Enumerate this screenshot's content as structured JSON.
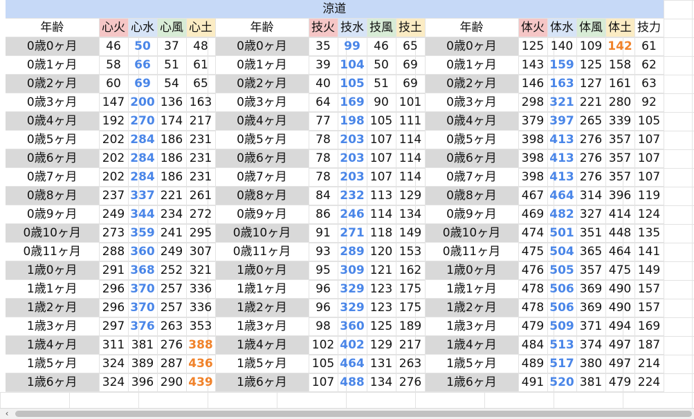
{
  "title": "涼道",
  "columns": [
    "年齢",
    "心火",
    "心水",
    "心風",
    "心土",
    "年齢",
    "技火",
    "技水",
    "技風",
    "技土",
    "年齢",
    "体火",
    "体水",
    "体風",
    "体土",
    "技力"
  ],
  "rows": [
    [
      "0歳0ヶ月",
      "46",
      "50",
      "37",
      "48",
      "0歳0ヶ月",
      "35",
      "99",
      "46",
      "65",
      "0歳0ヶ月",
      "125",
      "140",
      "109",
      "142",
      "61"
    ],
    [
      "0歳1ヶ月",
      "58",
      "66",
      "51",
      "61",
      "0歳1ヶ月",
      "39",
      "104",
      "50",
      "69",
      "0歳1ヶ月",
      "143",
      "159",
      "125",
      "158",
      "62"
    ],
    [
      "0歳2ヶ月",
      "60",
      "69",
      "54",
      "65",
      "0歳2ヶ月",
      "40",
      "105",
      "51",
      "69",
      "0歳2ヶ月",
      "146",
      "163",
      "127",
      "161",
      "63"
    ],
    [
      "0歳3ヶ月",
      "147",
      "200",
      "136",
      "163",
      "0歳3ヶ月",
      "64",
      "169",
      "90",
      "101",
      "0歳3ヶ月",
      "298",
      "321",
      "221",
      "280",
      "92"
    ],
    [
      "0歳4ヶ月",
      "192",
      "270",
      "174",
      "217",
      "0歳4ヶ月",
      "77",
      "198",
      "105",
      "111",
      "0歳4ヶ月",
      "379",
      "397",
      "265",
      "339",
      "105"
    ],
    [
      "0歳5ヶ月",
      "202",
      "284",
      "186",
      "231",
      "0歳5ヶ月",
      "78",
      "203",
      "107",
      "114",
      "0歳5ヶ月",
      "398",
      "413",
      "276",
      "357",
      "107"
    ],
    [
      "0歳6ヶ月",
      "202",
      "284",
      "186",
      "231",
      "0歳6ヶ月",
      "78",
      "203",
      "107",
      "114",
      "0歳6ヶ月",
      "398",
      "413",
      "276",
      "357",
      "107"
    ],
    [
      "0歳7ヶ月",
      "202",
      "284",
      "186",
      "231",
      "0歳7ヶ月",
      "78",
      "203",
      "107",
      "114",
      "0歳7ヶ月",
      "398",
      "413",
      "276",
      "357",
      "107"
    ],
    [
      "0歳8ヶ月",
      "237",
      "337",
      "221",
      "261",
      "0歳8ヶ月",
      "84",
      "232",
      "113",
      "129",
      "0歳8ヶ月",
      "467",
      "464",
      "314",
      "396",
      "119"
    ],
    [
      "0歳9ヶ月",
      "249",
      "344",
      "234",
      "272",
      "0歳9ヶ月",
      "86",
      "246",
      "114",
      "134",
      "0歳9ヶ月",
      "469",
      "482",
      "327",
      "414",
      "124"
    ],
    [
      "0歳10ヶ月",
      "273",
      "359",
      "241",
      "295",
      "0歳10ヶ月",
      "91",
      "271",
      "118",
      "149",
      "0歳10ヶ月",
      "474",
      "501",
      "351",
      "448",
      "135"
    ],
    [
      "0歳11ヶ月",
      "288",
      "360",
      "249",
      "307",
      "0歳11ヶ月",
      "93",
      "289",
      "120",
      "153",
      "0歳11ヶ月",
      "475",
      "504",
      "365",
      "464",
      "141"
    ],
    [
      "1歳0ヶ月",
      "291",
      "368",
      "252",
      "321",
      "1歳0ヶ月",
      "95",
      "309",
      "121",
      "162",
      "1歳0ヶ月",
      "476",
      "505",
      "357",
      "475",
      "149"
    ],
    [
      "1歳1ヶ月",
      "296",
      "370",
      "257",
      "336",
      "1歳1ヶ月",
      "96",
      "329",
      "123",
      "175",
      "1歳1ヶ月",
      "478",
      "506",
      "369",
      "490",
      "157"
    ],
    [
      "1歳2ヶ月",
      "296",
      "370",
      "257",
      "336",
      "1歳2ヶ月",
      "96",
      "329",
      "123",
      "175",
      "1歳2ヶ月",
      "478",
      "506",
      "369",
      "490",
      "157"
    ],
    [
      "1歳3ヶ月",
      "297",
      "376",
      "263",
      "353",
      "1歳3ヶ月",
      "98",
      "360",
      "125",
      "189",
      "1歳3ヶ月",
      "479",
      "509",
      "371",
      "494",
      "169"
    ],
    [
      "1歳4ヶ月",
      "311",
      "381",
      "276",
      "388",
      "1歳4ヶ月",
      "102",
      "402",
      "129",
      "217",
      "1歳4ヶ月",
      "484",
      "513",
      "374",
      "497",
      "187"
    ],
    [
      "1歳5ヶ月",
      "324",
      "389",
      "287",
      "436",
      "1歳5ヶ月",
      "105",
      "464",
      "131",
      "263",
      "1歳5ヶ月",
      "489",
      "517",
      "380",
      "497",
      "214"
    ],
    [
      "1歳6ヶ月",
      "324",
      "396",
      "290",
      "439",
      "1歳6ヶ月",
      "107",
      "488",
      "134",
      "276",
      "1歳6ヶ月",
      "491",
      "520",
      "381",
      "479",
      "224"
    ]
  ],
  "highlight_colors": {
    "max_blue": "#4a86e8",
    "max_orange": "#f0822a",
    "title_bg": "#c6d9f7"
  },
  "ui": {
    "scroll_left_icon": "‹"
  }
}
